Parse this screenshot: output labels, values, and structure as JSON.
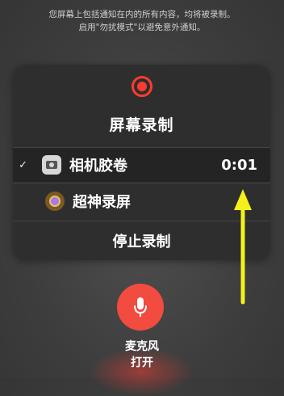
{
  "notice": {
    "line1": "您屏幕上包括通知在内的所有内容，均将被录制。",
    "line2": "启用\"勿扰模式\"以避免意外通知。"
  },
  "panel": {
    "title": "屏幕录制",
    "items": [
      {
        "label": "相机胶卷",
        "icon": "camera-roll-icon",
        "selected": true,
        "check": "✓",
        "timer": "0:01"
      },
      {
        "label": "超神录屏",
        "icon": "super-recorder-icon",
        "selected": false
      }
    ],
    "stop_label": "停止录制"
  },
  "microphone": {
    "label": "麦克风",
    "state": "打开"
  },
  "colors": {
    "record_red": "#ff3b30",
    "mic_red": "#f24b3f",
    "arrow_yellow": "#f5ef1c"
  }
}
